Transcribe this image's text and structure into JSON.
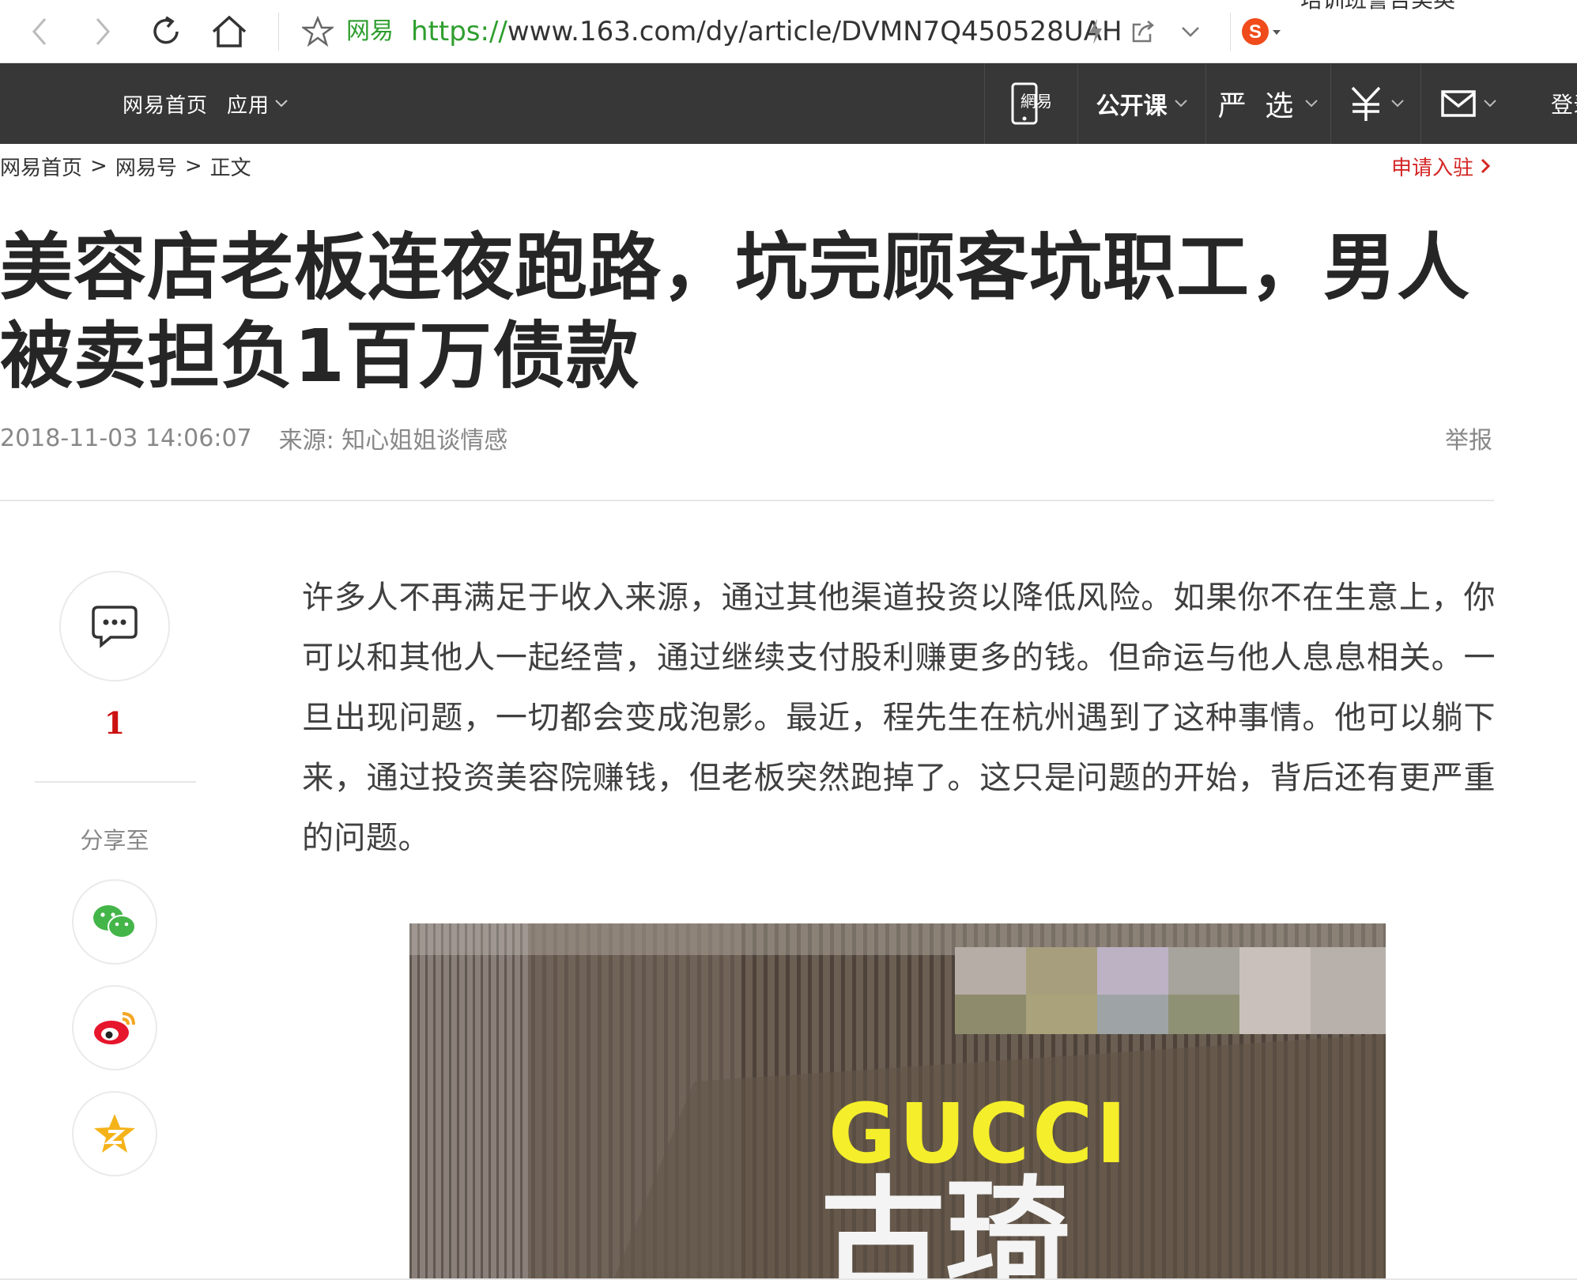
{
  "browser": {
    "site_name": "网易",
    "url_scheme": "https://",
    "url_rest": "www.163.com/dy/article/DVMN7Q450528UAH",
    "top_cut_text": "培训班警告美英"
  },
  "nav": {
    "home_label": "网易首页",
    "apps_label": "应用",
    "mobile_icon_text": "網易",
    "open_course_label": "公开课",
    "yanxuan_label": "严 选",
    "login_label": "登录"
  },
  "breadcrumb": {
    "items": [
      "网易首页",
      "网易号",
      "正文"
    ],
    "separator": ">"
  },
  "apply_link": "申请入驻",
  "article": {
    "title": "美容店老板连夜跑路，坑完顾客坑职工，男人被卖担负1百万债款",
    "datetime": "2018-11-03 14:06:07",
    "source_label": "来源:",
    "source_name": "知心姐姐谈情感",
    "report_label": "举报",
    "paragraph": "许多人不再满足于收入来源，通过其他渠道投资以降低风险。如果你不在生意上，你可以和其他人一起经营，通过继续支付股利赚更多的钱。但命运与他人息息相关。一旦出现问题，一切都会变成泡影。最近，程先生在杭州遇到了这种事情。他可以躺下来，通过投资美容院赚钱，但老板突然跑掉了。这只是问题的开始，背后还有更严重的问题。"
  },
  "sidebar": {
    "comment_count": "1",
    "share_label": "分享至"
  },
  "figure": {
    "sign_latin": "GUCCI",
    "sign_chinese": "古琦"
  },
  "colors": {
    "nav_bg": "#373737",
    "accent_red": "#d42525",
    "url_green": "#2e9e2e",
    "wechat_green": "#44b549",
    "weibo_red": "#e6162d",
    "qzone_yellow": "#f5b31a"
  }
}
